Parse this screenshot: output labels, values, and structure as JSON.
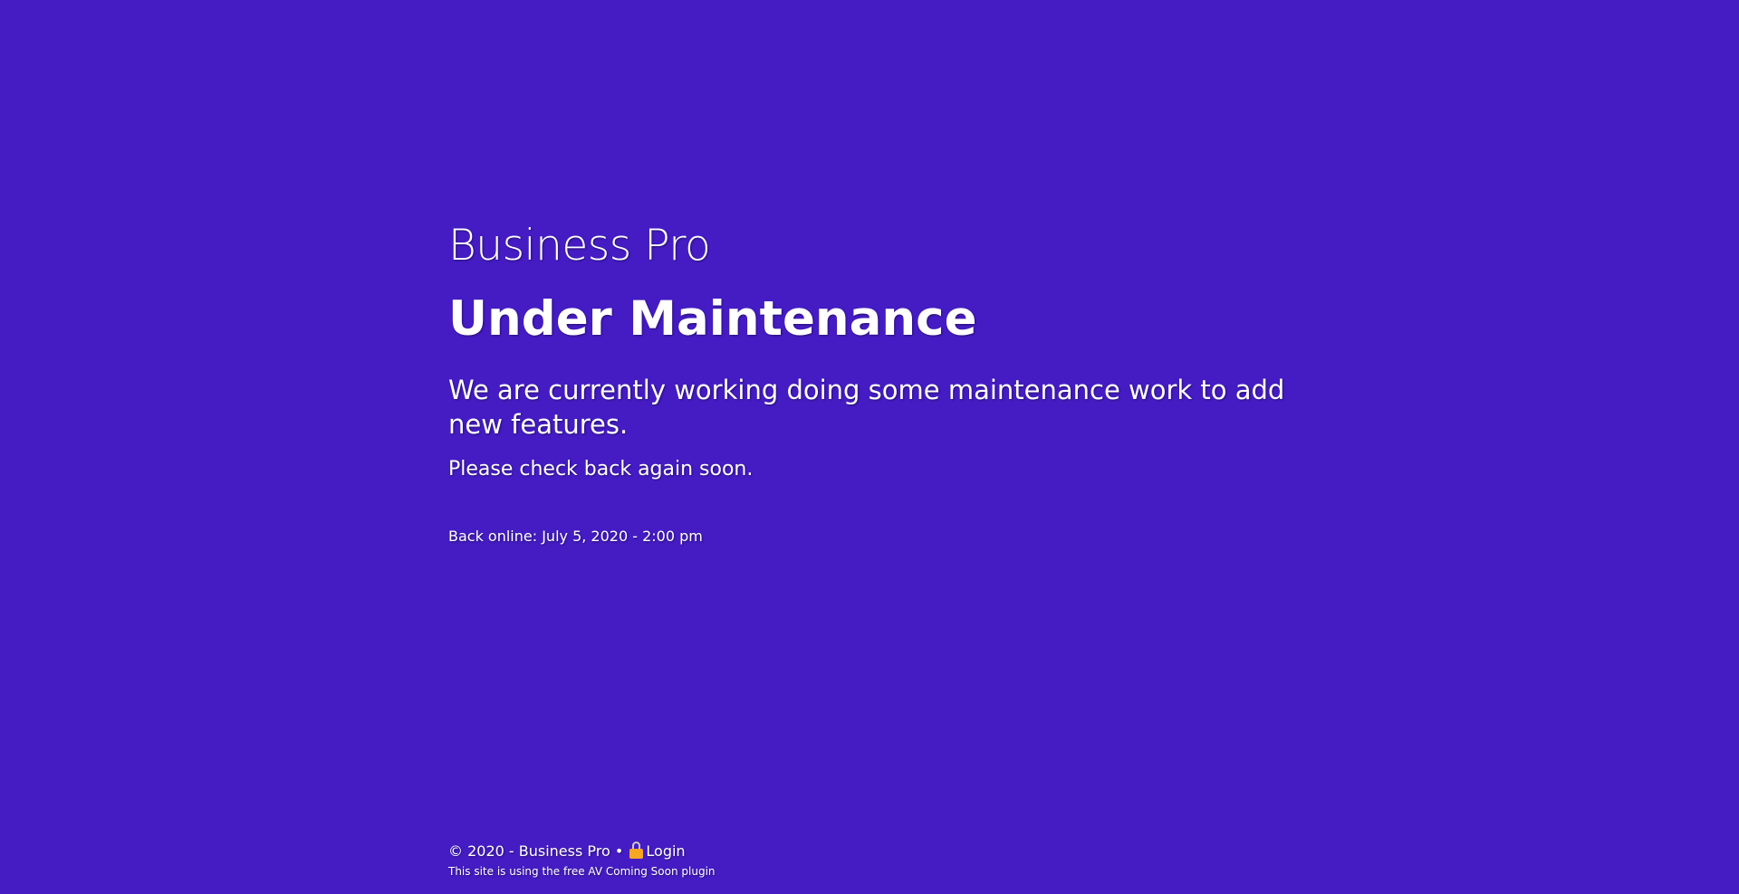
{
  "page": {
    "background_color": "#451cc4",
    "text_color": "#ffffff"
  },
  "header": {
    "site_title": "Business Pro"
  },
  "main": {
    "heading": "Under Maintenance",
    "lead": "We are currently working doing some maintenance work to add new features.",
    "sub": "Please check back again soon.",
    "countdown": "Back online: July 5, 2020 - 2:00 pm"
  },
  "footer": {
    "copyright": "© 2020 - Business Pro •",
    "lock_icon": "lock-icon",
    "login_label": "Login",
    "plugin_note": "This site is using the free AV Coming Soon plugin"
  }
}
